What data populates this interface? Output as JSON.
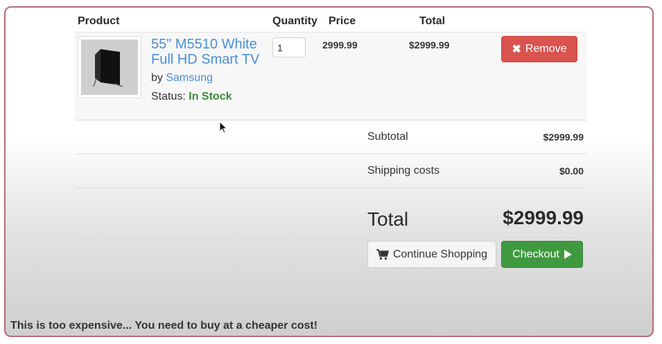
{
  "headers": {
    "product": "Product",
    "quantity": "Quantity",
    "price": "Price",
    "total": "Total"
  },
  "item": {
    "name": "55\" M5510 White Full HD Smart TV",
    "by_label": "by",
    "brand": "Samsung",
    "status_label": "Status:",
    "status": "In Stock",
    "quantity": "1",
    "price": "2999.99",
    "total": "$2999.99",
    "remove_label": "Remove",
    "image_icon": "tv-image"
  },
  "summary": {
    "subtotal_label": "Subtotal",
    "subtotal_value": "$2999.99",
    "shipping_label": "Shipping costs",
    "shipping_value": "$0.00",
    "total_label": "Total",
    "total_value": "$2999.99"
  },
  "actions": {
    "continue_label": "Continue Shopping",
    "continue_icon": "cart-icon",
    "checkout_label": "Checkout",
    "checkout_icon": "play-icon"
  },
  "caption": "This is too expensive... You need to buy at a cheaper cost!",
  "colors": {
    "link": "#4a8fd4",
    "in_stock": "#3a8a3a",
    "remove": "#d9534f",
    "checkout": "#3f9a3f",
    "frame_border": "#b86a78"
  }
}
